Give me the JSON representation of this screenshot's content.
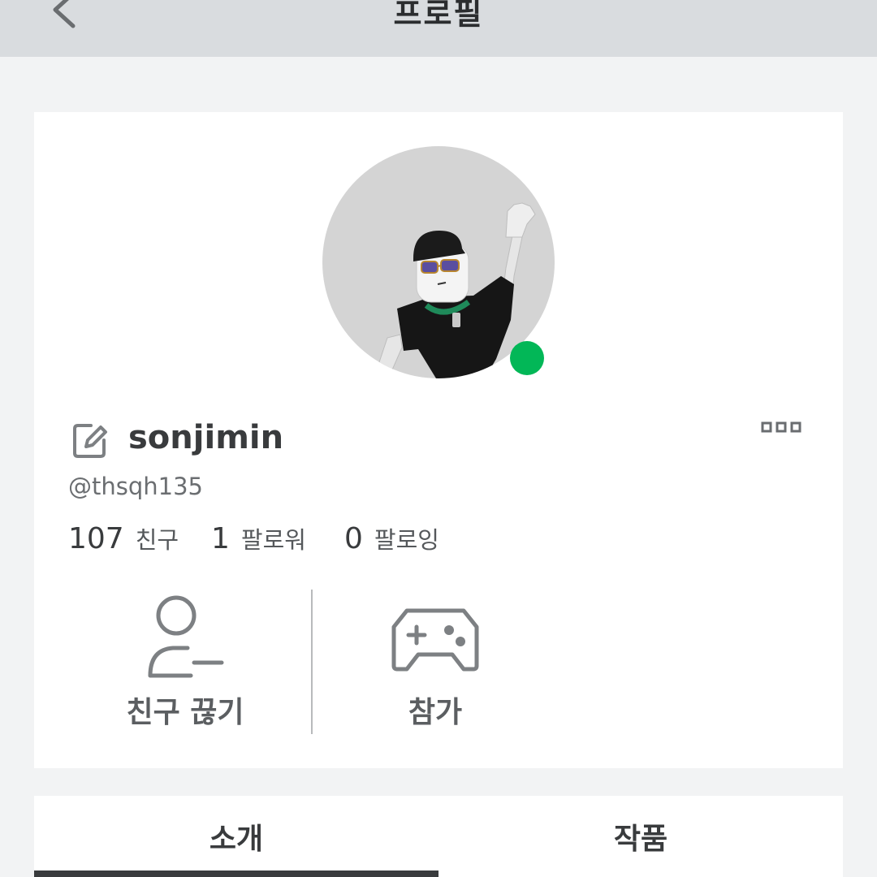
{
  "header": {
    "title": "프로필",
    "back_icon": "chevron-left-icon"
  },
  "profile": {
    "display_name": "sonjimin",
    "username": "@thsqh135",
    "online": true,
    "status_color": "#02b757"
  },
  "stats": [
    {
      "value": "107",
      "label": "친구"
    },
    {
      "value": "1",
      "label": "팔로워"
    },
    {
      "value": "0",
      "label": "팔로잉"
    }
  ],
  "actions": [
    {
      "label": "친구 끊기",
      "icon": "unfriend-icon"
    },
    {
      "label": "참가",
      "icon": "gamepad-icon"
    }
  ],
  "tabs": [
    {
      "label": "소개",
      "selected": true
    },
    {
      "label": "작품",
      "selected": false
    }
  ]
}
